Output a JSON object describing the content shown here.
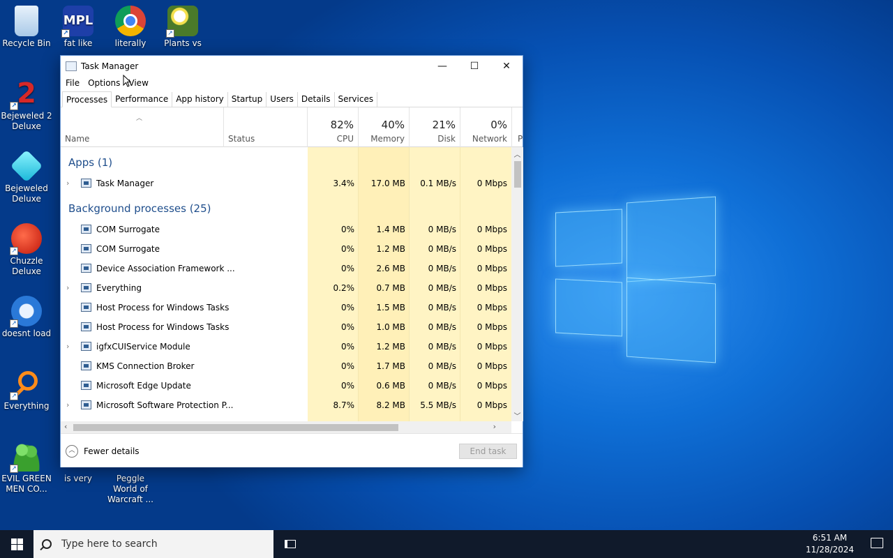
{
  "desktop": {
    "icons": [
      {
        "label": "Recycle Bin",
        "icon": "recycle-bin-icon"
      },
      {
        "label": "fat like",
        "icon": "mpl-app-icon"
      },
      {
        "label": "literally",
        "icon": "chrome-icon"
      },
      {
        "label": "Plants vs",
        "icon": "plants-vs-zombies-icon"
      },
      {
        "label": "Bejeweled 2 Deluxe",
        "icon": "bejeweled-2-icon"
      },
      {
        "label": "Bejeweled Deluxe",
        "icon": "bejeweled-icon"
      },
      {
        "label": "Chuzzle Deluxe",
        "icon": "chuzzle-icon"
      },
      {
        "label": "doesnt load",
        "icon": "thunderbird-icon"
      },
      {
        "label": "Everything",
        "icon": "everything-search-icon"
      },
      {
        "label": "EVIL GREEN MEN CO...",
        "icon": "people-icon"
      },
      {
        "label": "is very",
        "icon": "app-icon"
      },
      {
        "label": "Peggle World of Warcraft ...",
        "icon": "peggle-icon"
      }
    ]
  },
  "window": {
    "title": "Task Manager",
    "menu": [
      "File",
      "Options",
      "View"
    ],
    "tabs": [
      "Processes",
      "Performance",
      "App history",
      "Startup",
      "Users",
      "Details",
      "Services"
    ],
    "active_tab": "Processes"
  },
  "columns": {
    "name": "Name",
    "status": "Status",
    "cpu": {
      "pct": "82%",
      "label": "CPU"
    },
    "memory": {
      "pct": "40%",
      "label": "Memory"
    },
    "disk": {
      "pct": "21%",
      "label": "Disk"
    },
    "network": {
      "pct": "0%",
      "label": "Network"
    },
    "next": "P"
  },
  "groups": {
    "apps": "Apps (1)",
    "background": "Background processes (25)"
  },
  "apps": [
    {
      "name": "Task Manager",
      "cpu": "3.4%",
      "memory": "17.0 MB",
      "disk": "0.1 MB/s",
      "network": "0 Mbps",
      "expandable": true
    }
  ],
  "background": [
    {
      "name": "COM Surrogate",
      "cpu": "0%",
      "memory": "1.4 MB",
      "disk": "0 MB/s",
      "network": "0 Mbps",
      "expandable": false
    },
    {
      "name": "COM Surrogate",
      "cpu": "0%",
      "memory": "1.2 MB",
      "disk": "0 MB/s",
      "network": "0 Mbps",
      "expandable": false
    },
    {
      "name": "Device Association Framework ...",
      "cpu": "0%",
      "memory": "2.6 MB",
      "disk": "0 MB/s",
      "network": "0 Mbps",
      "expandable": false
    },
    {
      "name": "Everything",
      "cpu": "0.2%",
      "memory": "0.7 MB",
      "disk": "0 MB/s",
      "network": "0 Mbps",
      "expandable": true
    },
    {
      "name": "Host Process for Windows Tasks",
      "cpu": "0%",
      "memory": "1.5 MB",
      "disk": "0 MB/s",
      "network": "0 Mbps",
      "expandable": false
    },
    {
      "name": "Host Process for Windows Tasks",
      "cpu": "0%",
      "memory": "1.0 MB",
      "disk": "0 MB/s",
      "network": "0 Mbps",
      "expandable": false
    },
    {
      "name": "igfxCUIService Module",
      "cpu": "0%",
      "memory": "1.2 MB",
      "disk": "0 MB/s",
      "network": "0 Mbps",
      "expandable": true
    },
    {
      "name": "KMS Connection Broker",
      "cpu": "0%",
      "memory": "1.7 MB",
      "disk": "0 MB/s",
      "network": "0 Mbps",
      "expandable": false
    },
    {
      "name": "Microsoft Edge Update",
      "cpu": "0%",
      "memory": "0.6 MB",
      "disk": "0 MB/s",
      "network": "0 Mbps",
      "expandable": false
    },
    {
      "name": "Microsoft Software Protection P...",
      "cpu": "8.7%",
      "memory": "8.2 MB",
      "disk": "5.5 MB/s",
      "network": "0 Mbps",
      "expandable": true
    }
  ],
  "footer": {
    "fewer_details": "Fewer details",
    "end_task": "End task"
  },
  "taskbar": {
    "search_placeholder": "Type here to search",
    "time": "6:51 AM",
    "date": "11/28/2024"
  },
  "colors": {
    "heat_light": "#fff4c4",
    "heat_medium": "#ffe9a3",
    "group_text": "#1f4e8c",
    "taskbar": "#101a2b"
  }
}
